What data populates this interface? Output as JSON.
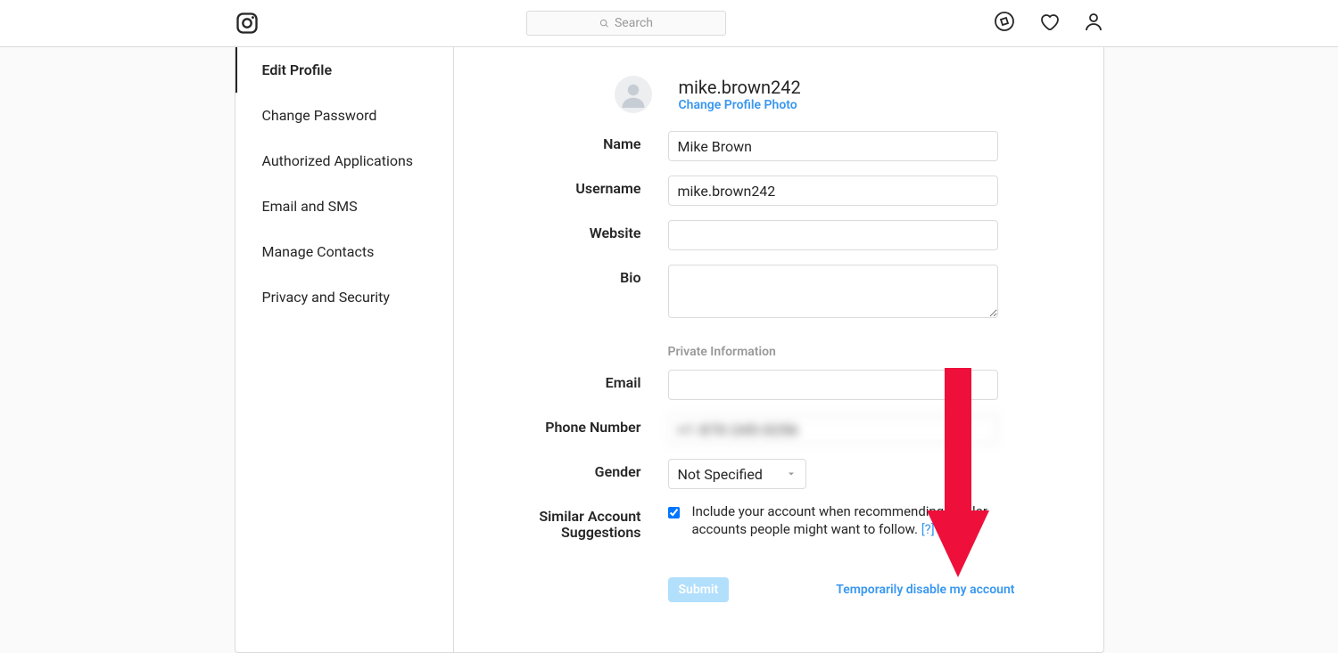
{
  "topbar": {
    "search_placeholder": "Search"
  },
  "sidebar": {
    "items": [
      "Edit Profile",
      "Change Password",
      "Authorized Applications",
      "Email and SMS",
      "Manage Contacts",
      "Privacy and Security"
    ]
  },
  "profile": {
    "username": "mike.brown242",
    "change_photo": "Change Profile Photo",
    "labels": {
      "name": "Name",
      "username": "Username",
      "website": "Website",
      "bio": "Bio",
      "private_info": "Private Information",
      "email": "Email",
      "phone": "Phone Number",
      "gender": "Gender",
      "similar": "Similar Account Suggestions"
    },
    "values": {
      "name": "Mike Brown",
      "username": "mike.brown242",
      "website": "",
      "bio": "",
      "email": "",
      "phone": "+1 870-245-0256",
      "gender": "Not Specified"
    },
    "similar_desc": "Include your account when recommending similar accounts people might want to follow.",
    "similar_help": "[?]",
    "submit": "Submit",
    "disable": "Temporarily disable my account"
  }
}
